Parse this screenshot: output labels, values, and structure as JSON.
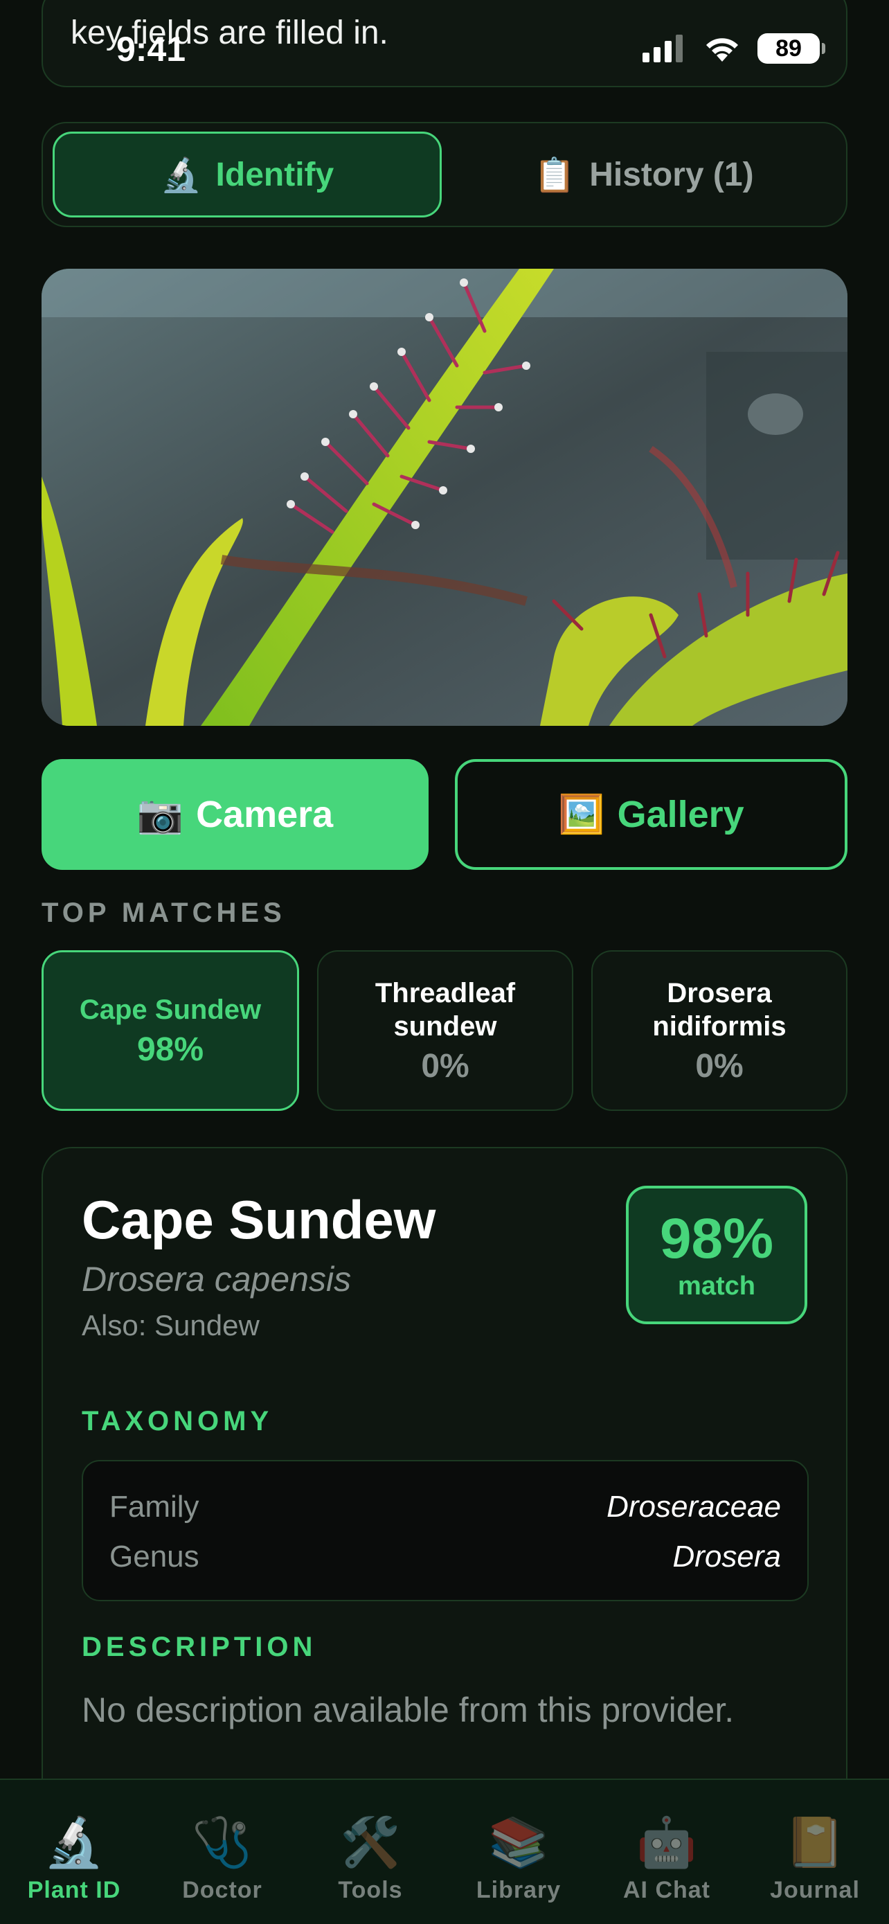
{
  "status_bar": {
    "time": "9:41",
    "battery": "89"
  },
  "banner": {
    "message": "key fields are filled in."
  },
  "segmented": [
    {
      "icon": "🔬",
      "label": "Identify",
      "active": true
    },
    {
      "icon": "📋",
      "label": "History (1)",
      "active": false
    }
  ],
  "actions": {
    "camera": {
      "icon": "📷",
      "label": "Camera"
    },
    "gallery": {
      "icon": "🖼️",
      "label": "Gallery"
    }
  },
  "top_matches": {
    "title": "TOP MATCHES",
    "items": [
      {
        "name": "Cape Sundew",
        "percent": "98%",
        "active": true
      },
      {
        "name": "Threadleaf sundew",
        "percent": "0%",
        "active": false
      },
      {
        "name": "Drosera nidiformis",
        "percent": "0%",
        "active": false
      }
    ]
  },
  "result": {
    "common_name": "Cape Sundew",
    "scientific_name": "Drosera capensis",
    "also": "Also: Sundew",
    "match_percent": "98%",
    "match_label": "match",
    "taxonomy_title": "TAXONOMY",
    "taxonomy": [
      {
        "key": "Family",
        "value": "Droseraceae"
      },
      {
        "key": "Genus",
        "value": "Drosera"
      }
    ],
    "description_title": "DESCRIPTION",
    "description": "No description available from this provider."
  },
  "tabbar": [
    {
      "icon": "🔬",
      "label": "Plant ID",
      "active": true
    },
    {
      "icon": "🩺",
      "label": "Doctor",
      "active": false
    },
    {
      "icon": "🛠️",
      "label": "Tools",
      "active": false
    },
    {
      "icon": "📚",
      "label": "Library",
      "active": false
    },
    {
      "icon": "🤖",
      "label": "AI Chat",
      "active": false
    },
    {
      "icon": "📔",
      "label": "Journal",
      "active": false
    }
  ],
  "colors": {
    "accent": "#47d67b",
    "background": "#0b100c",
    "card": "#0e1610",
    "muted": "#8a9390"
  }
}
